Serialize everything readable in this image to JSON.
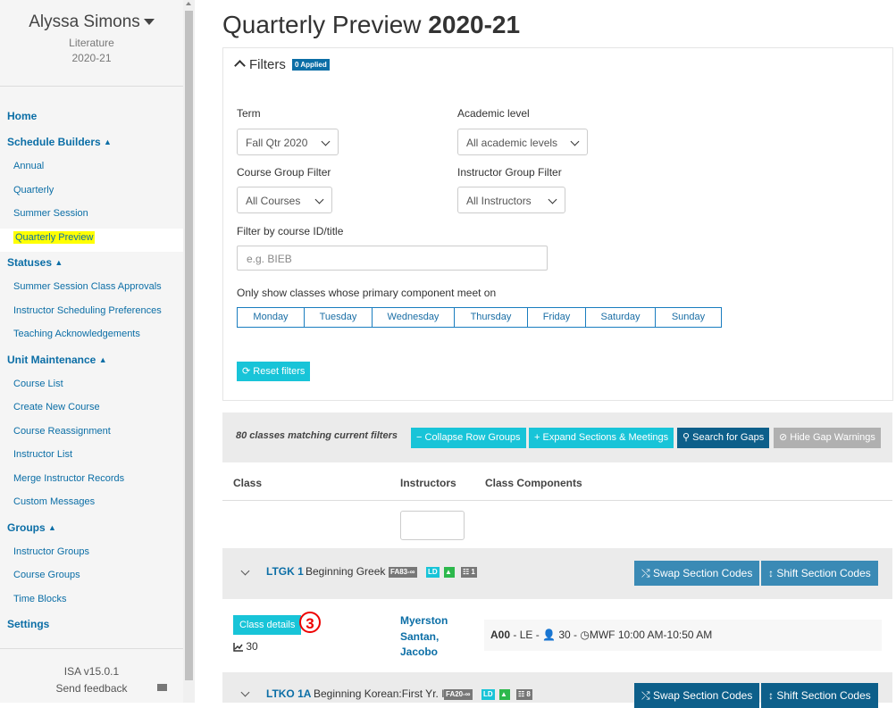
{
  "sidebar": {
    "user_name": "Alyssa Simons",
    "department": "Literature",
    "year": "2020-21",
    "home": "Home",
    "schedule_builders": "Schedule Builders",
    "schedule_items": [
      "Annual",
      "Quarterly",
      "Summer Session",
      "Quarterly Preview"
    ],
    "statuses": "Statuses",
    "status_items": [
      "Summer Session Class Approvals",
      "Instructor Scheduling Preferences",
      "Teaching Acknowledgements"
    ],
    "unit_maintenance": "Unit Maintenance",
    "unit_items": [
      "Course List",
      "Create New Course",
      "Course Reassignment",
      "Instructor List",
      "Merge Instructor Records",
      "Custom Messages"
    ],
    "groups": "Groups",
    "group_items": [
      "Instructor Groups",
      "Course Groups",
      "Time Blocks"
    ],
    "settings": "Settings",
    "version": "ISA v15.0.1",
    "feedback": "Send feedback"
  },
  "page": {
    "title": "Quarterly Preview",
    "year": "2020-21"
  },
  "filters": {
    "heading": "Filters",
    "applied_badge": "0 Applied",
    "term_label": "Term",
    "term_value": "Fall Qtr 2020",
    "academic_label": "Academic level",
    "academic_value": "All academic levels",
    "course_group_label": "Course Group Filter",
    "course_group_value": "All Courses",
    "instructor_group_label": "Instructor Group Filter",
    "instructor_group_value": "All Instructors",
    "course_id_label": "Filter by course ID/title",
    "course_id_placeholder": "e.g. BIEB",
    "days_label": "Only show classes whose primary component meet on",
    "days": [
      "Monday",
      "Tuesday",
      "Wednesday",
      "Thursday",
      "Friday",
      "Saturday",
      "Sunday"
    ],
    "reset": "Reset filters"
  },
  "results": {
    "count": "80 classes matching current filters",
    "collapse": "Collapse Row Groups",
    "expand": "Expand Sections & Meetings",
    "search_gaps": "Search for Gaps",
    "hide_gaps": "Hide Gap Warnings"
  },
  "table": {
    "col_class": "Class",
    "col_instructors": "Instructors",
    "col_components": "Class Components"
  },
  "groups": [
    {
      "code": "LTGK 1",
      "title": "Beginning Greek",
      "term_tag": "FA83-∞",
      "ld_tag": "LD",
      "group_count": "1",
      "swap": "Swap Section Codes",
      "shift": "Shift Section Codes"
    },
    {
      "code": "LTKO 1A",
      "title": "Beginning Korean:First Yr. I",
      "term_tag": "FA20-∞",
      "ld_tag": "LD",
      "group_count": "8",
      "swap": "Swap Section Codes",
      "shift": "Shift Section Codes"
    }
  ],
  "class_row": {
    "details": "Class details",
    "annotation": "3",
    "enrollment": "30",
    "instructors": [
      "Myerston",
      "Santan,",
      "Jacobo"
    ],
    "section": "A00",
    "component": "- LE -",
    "seats": "30 -",
    "schedule": "MWF 10:00 AM-10:50 AM"
  },
  "colors": {
    "link": "#0b6ea6",
    "cyan": "#18c4d8",
    "dark_blue": "#0d5f8a",
    "highlight": "#ffff00",
    "annotation": "#e00000"
  }
}
